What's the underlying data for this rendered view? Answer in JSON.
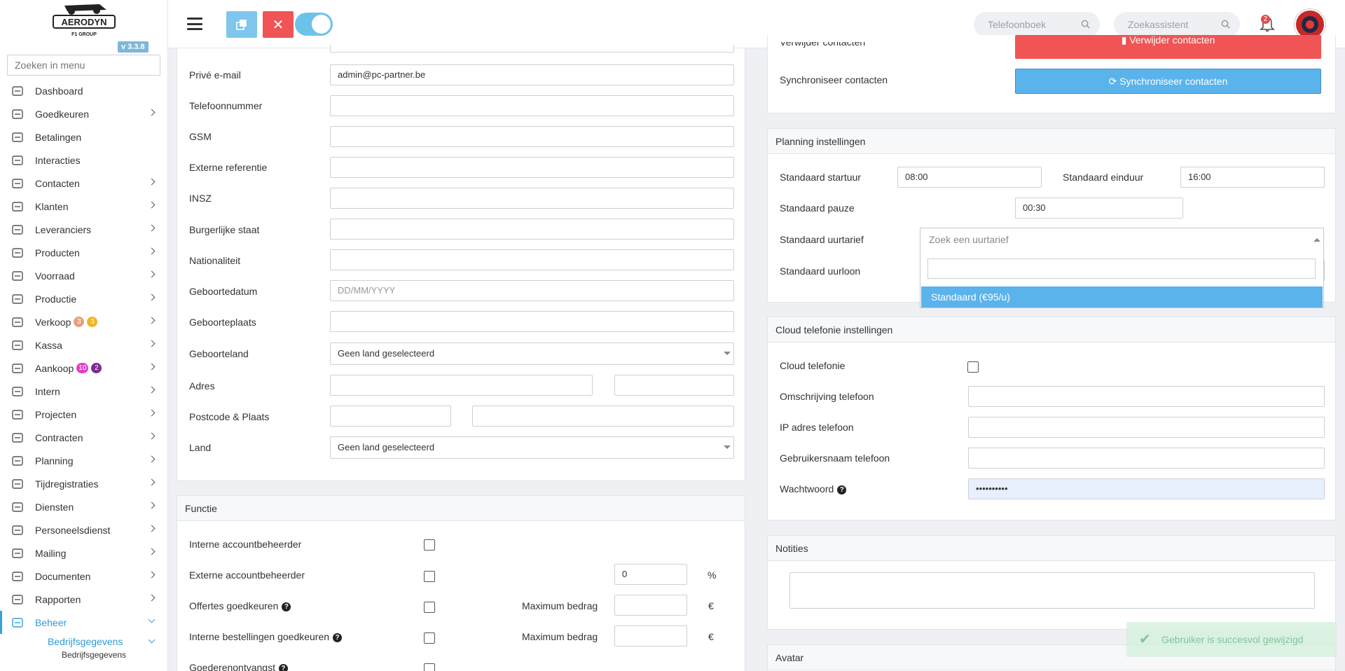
{
  "app": {
    "logo_text": "AERODYN",
    "logo_sub": "F1 GROUP",
    "version": "v 3.3.8"
  },
  "sidebar": {
    "search_placeholder": "Zoeken in menu",
    "items": [
      {
        "label": "Dashboard",
        "icon": "gauge-icon",
        "chevron": false
      },
      {
        "label": "Goedkeuren",
        "icon": "user-check-icon",
        "chevron": true
      },
      {
        "label": "Betalingen",
        "icon": "credit-card-icon",
        "chevron": false
      },
      {
        "label": "Interacties",
        "icon": "chat-icon",
        "chevron": false
      },
      {
        "label": "Contacten",
        "icon": "address-card-icon",
        "chevron": true
      },
      {
        "label": "Klanten",
        "icon": "customer-icon",
        "chevron": true
      },
      {
        "label": "Leveranciers",
        "icon": "truck-icon",
        "chevron": true
      },
      {
        "label": "Producten",
        "icon": "box-icon",
        "chevron": true
      },
      {
        "label": "Voorraad",
        "icon": "boxes-icon",
        "chevron": true
      },
      {
        "label": "Productie",
        "icon": "gears-icon",
        "chevron": true
      },
      {
        "label": "Verkoop",
        "icon": "euro-icon",
        "chevron": true,
        "badges": [
          {
            "text": "3",
            "color": "#e8a07c"
          },
          {
            "text": "3",
            "color": "#f0b429"
          }
        ]
      },
      {
        "label": "Kassa",
        "icon": "basket-icon",
        "chevron": true
      },
      {
        "label": "Aankoop",
        "icon": "cart-icon",
        "chevron": true,
        "badges": [
          {
            "text": "10",
            "color": "#e040c8"
          },
          {
            "text": "2",
            "color": "#7b2d8f"
          }
        ]
      },
      {
        "label": "Intern",
        "icon": "users-icon",
        "chevron": true
      },
      {
        "label": "Projecten",
        "icon": "diagram-icon",
        "chevron": true
      },
      {
        "label": "Contracten",
        "icon": "contract-icon",
        "chevron": true
      },
      {
        "label": "Planning",
        "icon": "calendar-icon",
        "chevron": true
      },
      {
        "label": "Tijdregistraties",
        "icon": "stopwatch-icon",
        "chevron": true
      },
      {
        "label": "Diensten",
        "icon": "repeat-icon",
        "chevron": true
      },
      {
        "label": "Personeelsdienst",
        "icon": "person-icon",
        "chevron": true
      },
      {
        "label": "Mailing",
        "icon": "paper-plane-icon",
        "chevron": true
      },
      {
        "label": "Documenten",
        "icon": "folder-icon",
        "chevron": true
      },
      {
        "label": "Rapporten",
        "icon": "chart-line-icon",
        "chevron": true
      },
      {
        "label": "Beheer",
        "icon": "wrench-icon",
        "chevron": true,
        "active": true
      }
    ],
    "sub_item": "Bedrijfsgegevens",
    "sub_sub_item": "Bedrijfsgegevens"
  },
  "topbar": {
    "copy_icon": "copy-icon",
    "close_icon": "close-icon",
    "phonebook_placeholder": "Telefoonboek",
    "assistant_placeholder": "Zoekassistent",
    "notification_count": "2"
  },
  "personal": {
    "private_email_label": "Privé e-mail",
    "private_email_value": "admin@pc-partner.be",
    "phone_label": "Telefoonnummer",
    "gsm_label": "GSM",
    "ext_ref_label": "Externe referentie",
    "insz_label": "INSZ",
    "civil_label": "Burgerlijke staat",
    "nationality_label": "Nationaliteit",
    "birthdate_label": "Geboortedatum",
    "birthdate_placeholder": "DD/MM/YYYY",
    "birthplace_label": "Geboorteplaats",
    "birthcountry_label": "Geboorteland",
    "birthcountry_value": "Geen land geselecteerd",
    "address_label": "Adres",
    "postcode_label": "Postcode & Plaats",
    "country_label": "Land",
    "country_value": "Geen land geselecteerd"
  },
  "functie": {
    "title": "Functie",
    "internal_manager_label": "Interne accountbeheerder",
    "external_manager_label": "Externe accountbeheerder",
    "external_pct_value": "0",
    "pct_unit": "%",
    "approve_quotes_label": "Offertes goedkeuren",
    "max_amount_label": "Maximum bedrag",
    "euro_unit": "€",
    "approve_internal_label": "Interne bestellingen goedkeuren",
    "max_amount_label_2": "Maximum bedrag",
    "goods_receipt_label": "Goederenontvangst"
  },
  "contacts_actions": {
    "delete_label": "Verwijder contacten",
    "delete_button": "Verwijder contacten",
    "sync_label": "Synchroniseer contacten",
    "sync_button": "Synchroniseer contacten"
  },
  "planning": {
    "title": "Planning instellingen",
    "start_label": "Standaard startuur",
    "start_value": "08:00",
    "end_label": "Standaard einduur",
    "end_value": "16:00",
    "pause_label": "Standaard pauze",
    "pause_value": "00:30",
    "rate_label": "Standaard uurtarief",
    "rate_placeholder": "Zoek een uurtarief",
    "rate_option": "Standaard (€95/u)",
    "wage_label": "Standaard uurloon"
  },
  "cloud": {
    "title": "Cloud telefonie instellingen",
    "enabled_label": "Cloud telefonie",
    "description_label": "Omschrijving telefoon",
    "ip_label": "IP adres telefoon",
    "username_label": "Gebruikersnaam telefoon",
    "password_label": "Wachtwoord",
    "password_value": "••••••••••"
  },
  "notes": {
    "title": "Notities"
  },
  "avatar_panel": {
    "title": "Avatar"
  },
  "toast": {
    "text": "Gebruiker is succesvol gewijzigd"
  }
}
